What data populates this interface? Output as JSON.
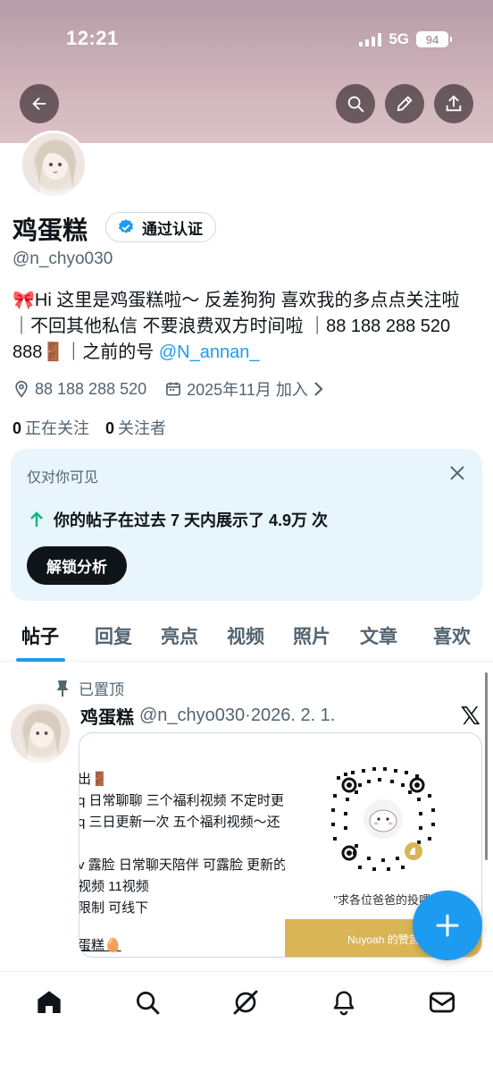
{
  "status_bar": {
    "time": "12:21",
    "network": "5G",
    "battery": "94"
  },
  "profile": {
    "name": "鸡蛋糕",
    "verified_label": "通过认证",
    "handle": "@n_chyo030",
    "bio_text": "🎀Hi 这里是鸡蛋糕啦～ 反差狗狗 喜欢我的多点点关注啦 ｜不回其他私信 不要浪费双方时间啦 ｜88 188 288 520 888🚪｜之前的号 ",
    "bio_mention": "@N_annan_",
    "location": "88 188 288 520",
    "joined": "2025年11月 加入",
    "following_count": "0",
    "following_label": "正在关注",
    "followers_count": "0",
    "followers_label": "关注者"
  },
  "insight_card": {
    "title": "仅对你可见",
    "text": "你的帖子在过去 7 天内展示了 4.9万 次",
    "button": "解锁分析"
  },
  "tabs": [
    {
      "label": "帖子"
    },
    {
      "label": "回复"
    },
    {
      "label": "亮点"
    },
    {
      "label": "视频"
    },
    {
      "label": "照片"
    },
    {
      "label": "文章"
    },
    {
      "label": "喜欢"
    }
  ],
  "post": {
    "pinned_label": "已置顶",
    "author_name": "鸡蛋糕",
    "author_handle": "@n_chyo030",
    "date": "2026. 2. 1.",
    "image_lines": [
      "出🚪",
      "q 日常聊聊 三个福利视频 不定时更",
      "q 三日更新一次 五个福利视频～还",
      "",
      "v 露脸 日常聊天陪伴 可露脸 更新的",
      "视频 11视频",
      "限制 可线下",
      "",
      "蛋糕🥚"
    ],
    "qr_caption": "\"求各位爸爸的投喂\"",
    "qr_band_text": "Nuyoah 的赞赏码"
  },
  "icons": {
    "back": "back-arrow-icon",
    "search": "search-icon",
    "edit": "pencil-icon",
    "share": "share-icon",
    "location": "location-pin-icon",
    "calendar": "calendar-icon",
    "pin": "pin-icon",
    "x": "x-logo-icon"
  },
  "colors": {
    "accent": "#1d9bf0",
    "banner": "#cfb4bc",
    "card_bg": "#e8f5fd",
    "up_arrow": "#00ba7c"
  }
}
